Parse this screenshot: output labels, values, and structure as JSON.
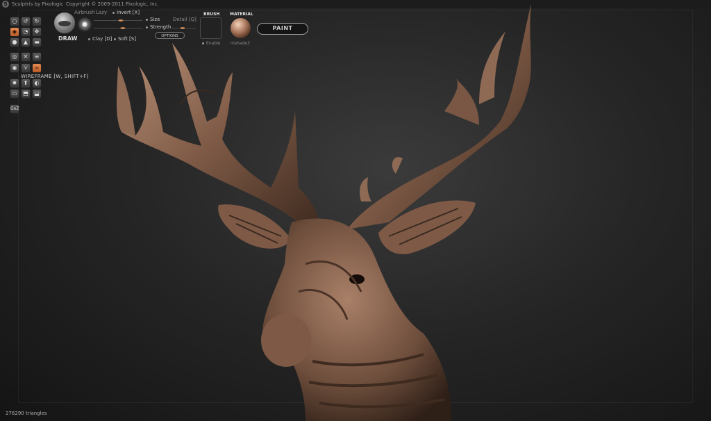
{
  "titlebar": {
    "logo": "S",
    "app": "Sculptris by Pixologic",
    "copyright": "Copyright © 2009-2011 Pixologic, Inc."
  },
  "toolbar": {
    "brush_name": "DRAW",
    "airbrush": "Airbrush",
    "lazy": "Lazy",
    "invert": "Invert [X]",
    "size": "Size",
    "strength": "Strength",
    "detail": "Detail [Q]",
    "options": "OPTIONS",
    "clay": "Clay [D]",
    "soft": "Soft [S]",
    "size_level": 0.55,
    "strength_level": 0.6,
    "detail_level": 0.45
  },
  "brush_panel": {
    "header": "BRUSH",
    "enable": "Enable"
  },
  "material_panel": {
    "header": "MATERIAL",
    "name": "mshade3"
  },
  "paint_button": "PAINT",
  "left_tools": {
    "wireframe_label": "WIREFRAME [W, SHIFT+F]",
    "goz_label": "GoZ"
  },
  "status": {
    "triangles": "276290 triangles"
  },
  "colors": {
    "accent_orange": "#d0743c",
    "model_bronze": "#8e6a55",
    "background": "#262626"
  }
}
